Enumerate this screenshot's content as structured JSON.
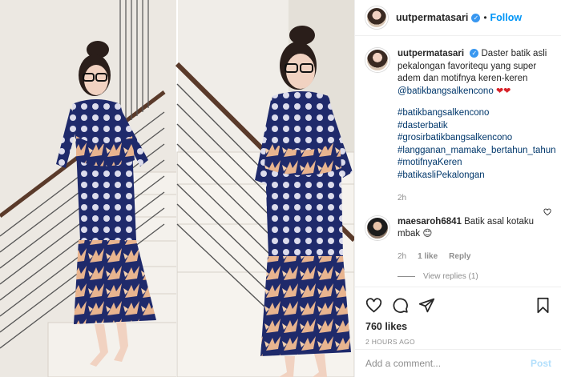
{
  "post": {
    "username": "uutpermatasari",
    "verified": true,
    "separator": "•",
    "follow_label": "Follow"
  },
  "caption": {
    "username": "uutpermatasari",
    "text": "Daster batik asli pekalongan favoritequ yang super adem dan motifnya keren-keren",
    "mention": "@batikbangsalkencono",
    "hearts": "❤❤",
    "hashtags": [
      "#batikbangsalkencono",
      "#dasterbatik",
      "#grosirbatikbangsalkencono",
      "#langganan_mamake_bertahun_tahun",
      "#motifnyaKeren",
      "#batikasliPekalongan"
    ],
    "time": "2h"
  },
  "comment": {
    "username": "maesaroh6841",
    "text": "Batik asal kotaku mbak",
    "emoji": "😊",
    "time": "2h",
    "likes": "1 like",
    "reply_label": "Reply",
    "view_replies": "View replies (1)"
  },
  "actions": {
    "likes_count": "760 likes",
    "posted_ago": "2 HOURS AGO"
  },
  "composer": {
    "placeholder": "Add a comment...",
    "post_label": "Post"
  },
  "colors": {
    "accent": "#0095f6",
    "verified": "#3897f0",
    "dress_navy": "#1f2a6b",
    "dress_peach": "#e8b48f"
  },
  "icons": [
    "verified-badge-icon",
    "heart-icon",
    "comment-icon",
    "share-icon",
    "save-icon",
    "heart-small-icon"
  ]
}
